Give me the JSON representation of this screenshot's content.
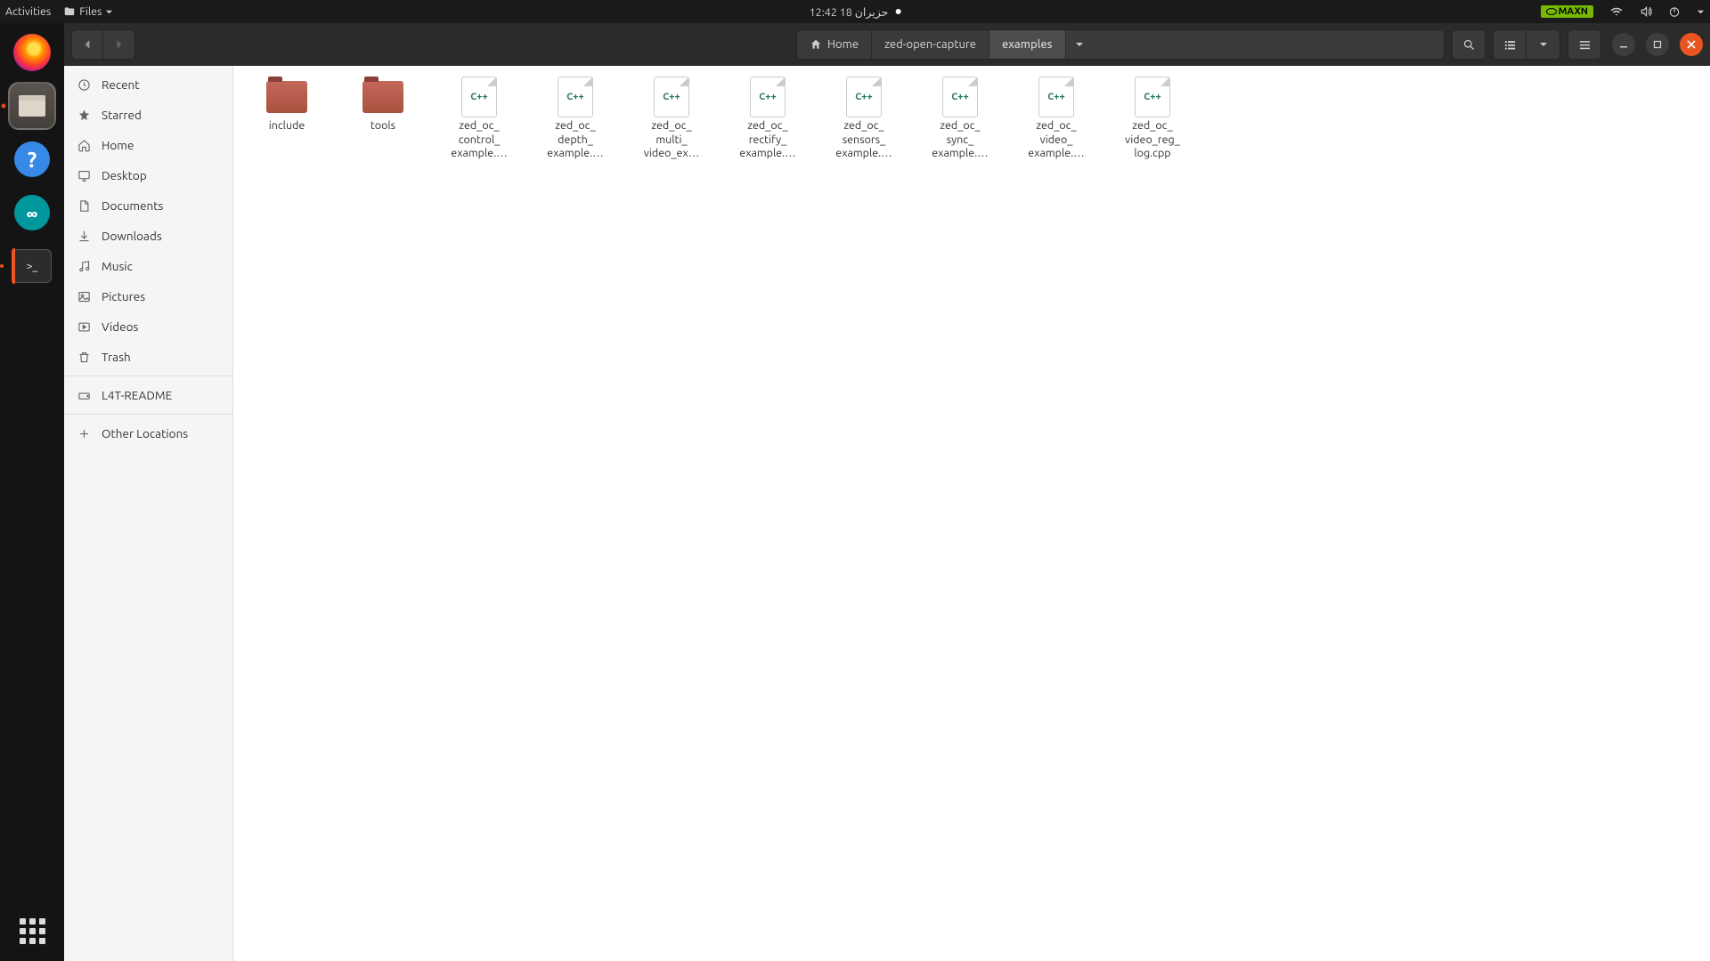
{
  "top_panel": {
    "activities": "Activities",
    "files_menu": "Files",
    "clock": "12:42  18 حزيران",
    "gpu_mode": "MAXN"
  },
  "titlebar": {
    "breadcrumbs": [
      "Home",
      "zed-open-capture",
      "examples"
    ]
  },
  "sidebar": {
    "items": [
      {
        "label": "Recent",
        "icon": "clock-icon"
      },
      {
        "label": "Starred",
        "icon": "star-icon"
      },
      {
        "label": "Home",
        "icon": "home-icon"
      },
      {
        "label": "Desktop",
        "icon": "desktop-icon"
      },
      {
        "label": "Documents",
        "icon": "documents-icon"
      },
      {
        "label": "Downloads",
        "icon": "downloads-icon"
      },
      {
        "label": "Music",
        "icon": "music-icon"
      },
      {
        "label": "Pictures",
        "icon": "pictures-icon"
      },
      {
        "label": "Videos",
        "icon": "videos-icon"
      },
      {
        "label": "Trash",
        "icon": "trash-icon"
      }
    ],
    "devices": [
      {
        "label": "L4T-README",
        "icon": "drive-icon"
      }
    ],
    "other": {
      "label": "Other Locations",
      "icon": "plus-icon"
    }
  },
  "files": [
    {
      "name": "include",
      "type": "folder"
    },
    {
      "name": "tools",
      "type": "folder"
    },
    {
      "name": "zed_oc_\ncontrol_\nexample.…",
      "type": "cpp"
    },
    {
      "name": "zed_oc_\ndepth_\nexample.…",
      "type": "cpp"
    },
    {
      "name": "zed_oc_\nmulti_\nvideo_ex…",
      "type": "cpp"
    },
    {
      "name": "zed_oc_\nrectify_\nexample.…",
      "type": "cpp"
    },
    {
      "name": "zed_oc_\nsensors_\nexample.…",
      "type": "cpp"
    },
    {
      "name": "zed_oc_\nsync_\nexample.…",
      "type": "cpp"
    },
    {
      "name": "zed_oc_\nvideo_\nexample.…",
      "type": "cpp"
    },
    {
      "name": "zed_oc_\nvideo_reg_\nlog.cpp",
      "type": "cpp"
    }
  ],
  "cpp_badge": "C++"
}
